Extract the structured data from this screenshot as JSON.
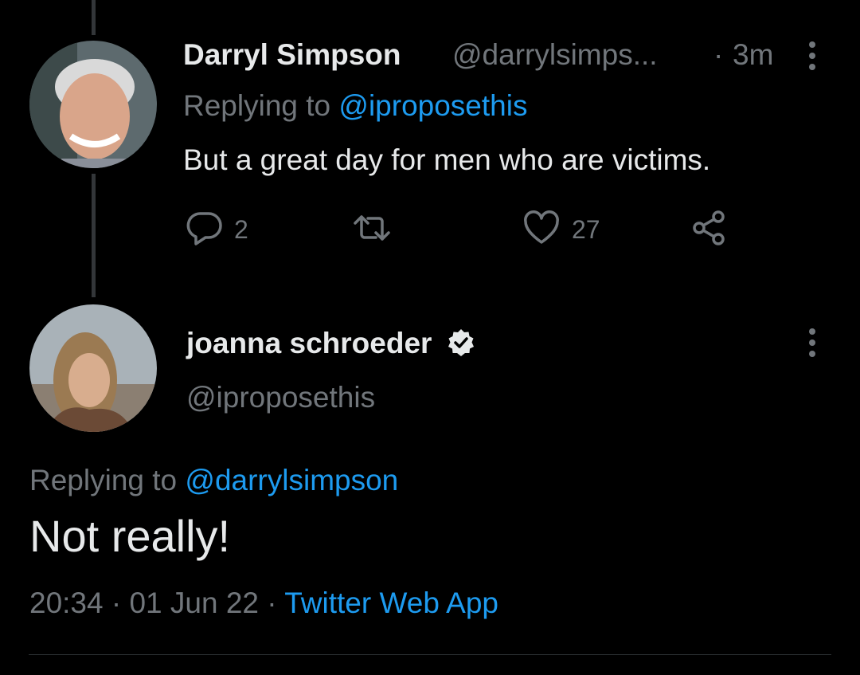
{
  "reply_tweet": {
    "author_name": "Darryl Simpson",
    "author_handle": "@darrylsimps...",
    "time_separator": "·",
    "time": "3m",
    "replying_prefix": "Replying to",
    "replying_handle": "@iproposethis",
    "text": "But a great day for men who are victims.",
    "actions": {
      "reply_count": "2",
      "retweet_count": "",
      "like_count": "27"
    },
    "icons": [
      "avatar",
      "reply-icon",
      "retweet-icon",
      "heart-icon",
      "share-icon",
      "more-icon"
    ]
  },
  "main_tweet": {
    "author_name": "joanna schroeder",
    "author_handle": "@iproposethis",
    "verified": true,
    "replying_prefix": "Replying to",
    "replying_handle": "@darrylsimpson",
    "text": "Not really!",
    "meta": {
      "time": "20:34",
      "sep1": "·",
      "date": "01 Jun 22",
      "sep2": "·",
      "source": "Twitter Web App"
    },
    "icons": [
      "avatar",
      "verified-badge-icon",
      "more-icon"
    ]
  },
  "colors": {
    "background": "#000000",
    "text": "#e7e9ea",
    "muted": "#71767b",
    "link": "#1d9bf0",
    "thread_line": "#333639"
  }
}
